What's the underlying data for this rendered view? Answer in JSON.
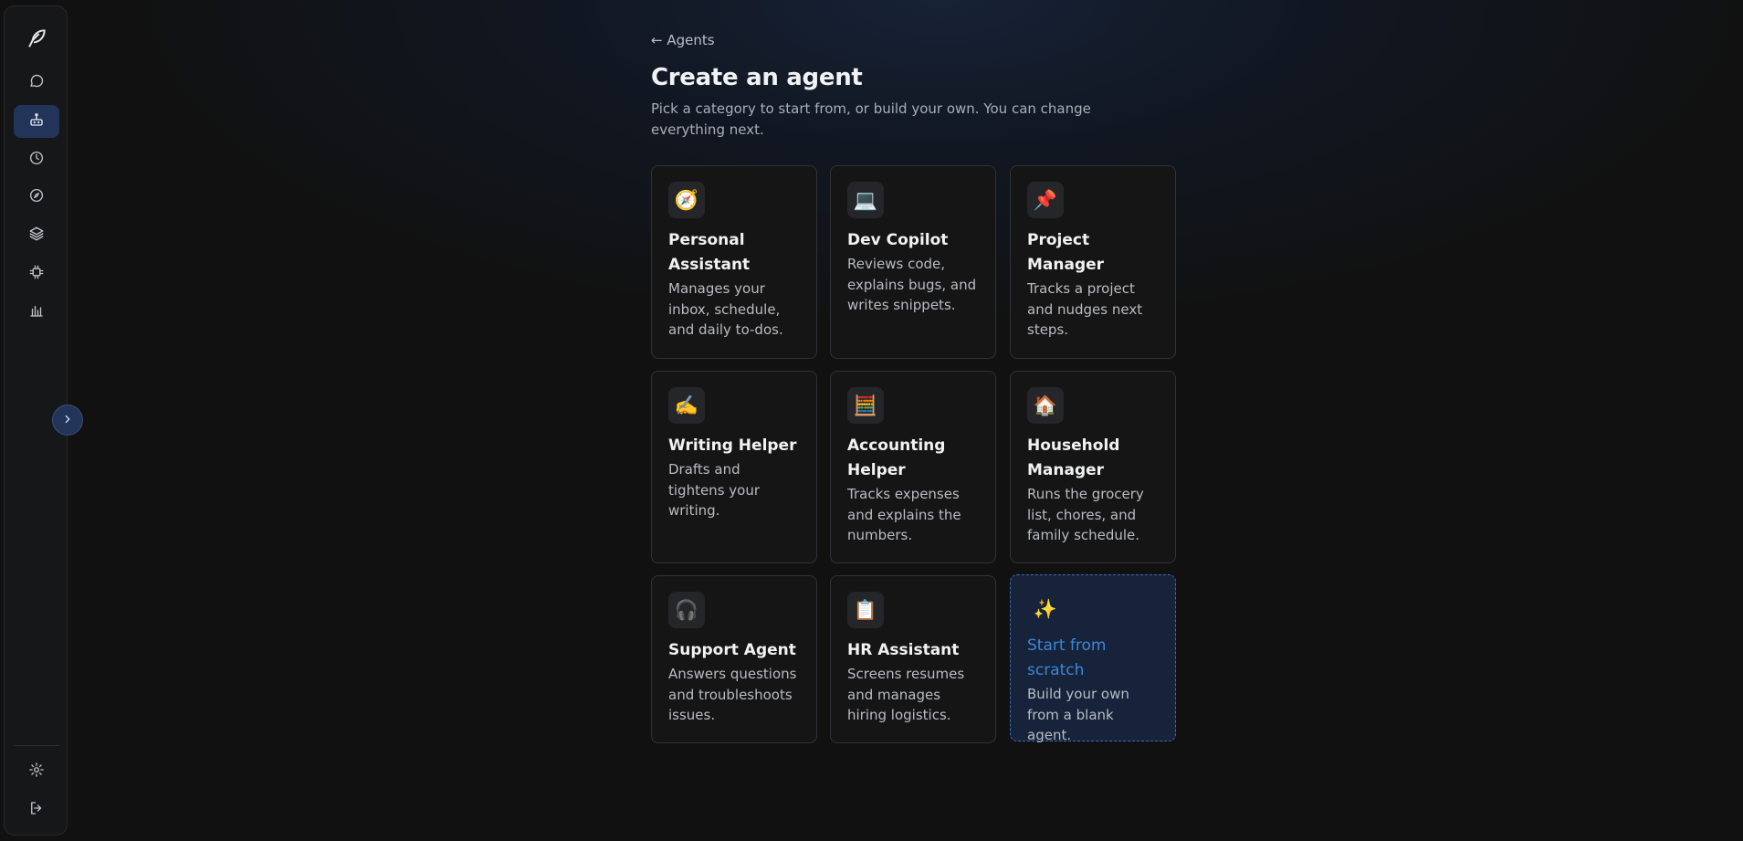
{
  "sidebar": {
    "logo_icon": "feather-pen-icon",
    "nav_items": [
      {
        "id": "chat",
        "icon": "chat-bubble-icon",
        "active": false
      },
      {
        "id": "agents",
        "icon": "robot-icon",
        "active": true
      },
      {
        "id": "history",
        "icon": "clock-icon",
        "active": false
      },
      {
        "id": "explore",
        "icon": "compass-icon",
        "active": false
      },
      {
        "id": "layers",
        "icon": "layers-icon",
        "active": false
      },
      {
        "id": "integrations",
        "icon": "chip-icon",
        "active": false
      },
      {
        "id": "analytics",
        "icon": "bar-chart-icon",
        "active": false
      }
    ],
    "bottom_items": [
      {
        "id": "settings",
        "icon": "gear-icon"
      },
      {
        "id": "logout",
        "icon": "logout-icon"
      }
    ],
    "collapse_icon": "chevron-right-icon"
  },
  "header": {
    "back_label": "← Agents",
    "title": "Create an agent",
    "subtitle": "Pick a category to start from, or build your own. You can change everything next."
  },
  "cards": [
    {
      "emoji": "🧭",
      "icon": "compass-emoji-icon",
      "name": "Personal Assistant",
      "description": "Manages your inbox, schedule, and daily to-dos."
    },
    {
      "emoji": "💻",
      "icon": "laptop-emoji-icon",
      "name": "Dev Copilot",
      "description": "Reviews code, explains bugs, and writes snippets."
    },
    {
      "emoji": "📌",
      "icon": "pushpin-emoji-icon",
      "name": "Project Manager",
      "description": "Tracks a project and nudges next steps."
    },
    {
      "emoji": "✍️",
      "icon": "writing-hand-emoji-icon",
      "name": "Writing Helper",
      "description": "Drafts and tightens your writing."
    },
    {
      "emoji": "🧮",
      "icon": "abacus-emoji-icon",
      "name": "Accounting Helper",
      "description": "Tracks expenses and explains the numbers."
    },
    {
      "emoji": "🏠",
      "icon": "house-emoji-icon",
      "name": "Household Manager",
      "description": "Runs the grocery list, chores, and family schedule."
    },
    {
      "emoji": "🎧",
      "icon": "headphones-emoji-icon",
      "name": "Support Agent",
      "description": "Answers questions and troubleshoots issues."
    },
    {
      "emoji": "📋",
      "icon": "clipboard-emoji-icon",
      "name": "HR Assistant",
      "description": "Screens resumes and manages hiring logistics."
    },
    {
      "emoji": "✨",
      "icon": "sparkles-emoji-icon",
      "name": "Start from scratch",
      "description": "Build your own from a blank agent."
    }
  ],
  "colors": {
    "accent": "#3d86d6",
    "active_nav_bg": "#22345a",
    "card_bg": "#151515",
    "scratch_bg": "#16233a"
  }
}
